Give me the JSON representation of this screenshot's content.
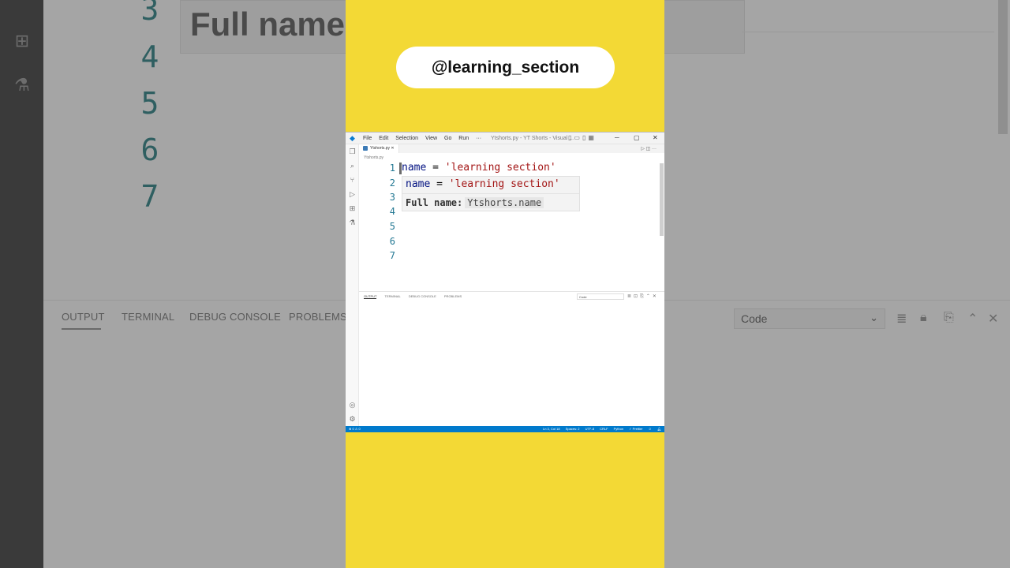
{
  "background": {
    "line_numbers": [
      "3",
      "4",
      "5",
      "6",
      "7"
    ],
    "hover_text": "Full name",
    "panel_tabs": [
      "OUTPUT",
      "TERMINAL",
      "DEBUG CONSOLE",
      "PROBLEMS"
    ],
    "dropdown_value": "Code"
  },
  "overlay": {
    "channel_handle": "@learning_section"
  },
  "vscode": {
    "menu": [
      "File",
      "Edit",
      "Selection",
      "View",
      "Go",
      "Run",
      "···"
    ],
    "window_title": "Ytshorts.py - YT Shorts - Visual ...",
    "tab_label": "Ytshorts.py",
    "breadcrumb": "Ytshorts.py",
    "editor": {
      "line_numbers": [
        "1",
        "2",
        "3",
        "4",
        "5",
        "6",
        "7"
      ],
      "line1": {
        "ident": "name",
        "op": " = ",
        "str": "'learning section'"
      }
    },
    "hover": {
      "code_ident": "name",
      "code_op": " = ",
      "code_str": "'learning section'",
      "full_label": "Full name:",
      "full_value": "Ytshorts.name"
    },
    "panel": {
      "tabs": [
        "OUTPUT",
        "TERMINAL",
        "DEBUG CONSOLE",
        "PROBLEMS"
      ],
      "select_value": "Code"
    },
    "statusbar": {
      "left": "⊗ 0 ⚠ 0",
      "items": [
        "Ln 3, Col 18",
        "Spaces: 2",
        "UTF-8",
        "CRLF",
        "Python",
        "✓ Prettier"
      ]
    }
  },
  "colors": {
    "strip_yellow": "#f3d935",
    "statusbar_blue": "#007acc",
    "string_red": "#a31515",
    "identifier_blue": "#001080",
    "line_number_teal": "#237893"
  }
}
